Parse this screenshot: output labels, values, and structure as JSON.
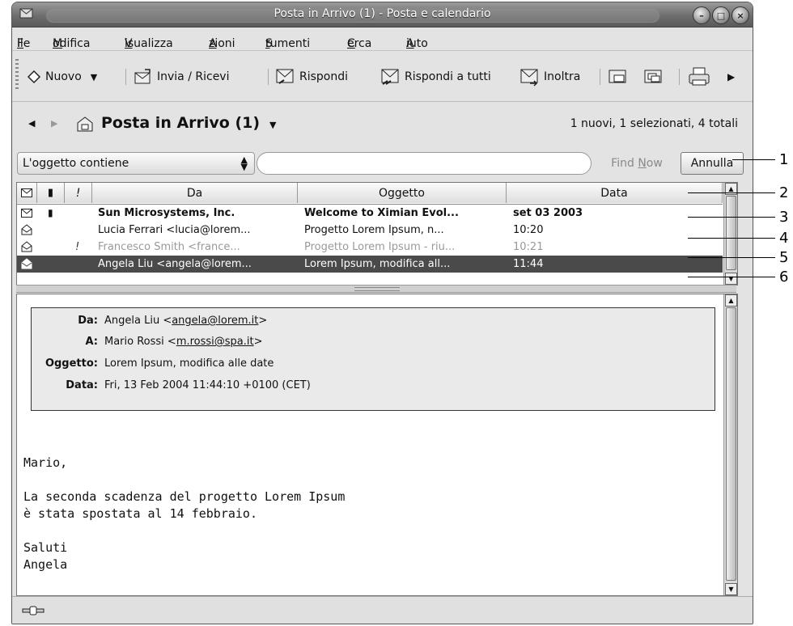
{
  "window": {
    "title": "Posta in Arrivo (1) - Posta e calendario"
  },
  "menu": [
    {
      "label": "File",
      "key": "F",
      "rest": "ile"
    },
    {
      "label": "Modifica",
      "key": "M",
      "rest": "odifica"
    },
    {
      "label": "Visualizza",
      "key": "V",
      "rest": "isualizza"
    },
    {
      "label": "Azioni",
      "key": "A",
      "rest": "zioni"
    },
    {
      "label": "Strumenti",
      "pre": "S",
      "key": "t",
      "rest": "rumenti"
    },
    {
      "label": "Cerca",
      "key": "C",
      "rest": "erca"
    },
    {
      "label": "Aiuto",
      "key": "A",
      "rest": "iuto"
    }
  ],
  "toolbar": {
    "new": "Nuovo",
    "send_receive": "Invia / Ricevi",
    "reply": "Rispondi",
    "reply_all": "Rispondi a tutti",
    "forward": "Inoltra"
  },
  "nav": {
    "folder": "Posta in Arrivo (1)",
    "counts": "1 nuovi, 1 selezionati, 4 totali"
  },
  "search": {
    "criteria": "L'oggetto contiene",
    "query": "",
    "find_now": "Find Now",
    "find_now_key": "N",
    "cancel": "Annulla"
  },
  "columns": {
    "from": "Da",
    "subject": "Oggetto",
    "date": "Data"
  },
  "messages": [
    {
      "from": "Sun Microsystems, Inc.",
      "subject": "Welcome to Ximian Evol...",
      "date": "set 03 2003",
      "flag": "",
      "unread": true,
      "attachment": true
    },
    {
      "from": "Lucia Ferrari <lucia@lorem...",
      "subject": "Progetto Lorem Ipsum, n...",
      "date": "10:20",
      "flag": "",
      "unread": false
    },
    {
      "from": "Francesco Smith <france...",
      "subject": "Progetto Lorem Ipsum - riu...",
      "date": "10:21",
      "flag": "!",
      "unread": false
    },
    {
      "from": "Angela Liu <angela@lorem...",
      "subject": "Lorem Ipsum, modifica all...",
      "date": "11:44",
      "flag": "",
      "unread": false,
      "selected": true
    }
  ],
  "preview": {
    "labels": {
      "from": "Da:",
      "to": "A:",
      "subject": "Oggetto:",
      "date": "Data:"
    },
    "from_name": "Angela Liu <",
    "from_email": "angela@lorem.it",
    "to_name": "Mario Rossi <",
    "to_email": "m.rossi@spa.it",
    "subject": "Lorem Ipsum, modifica alle date",
    "date": "Fri, 13 Feb 2004 11:44:10 +0100 (CET)",
    "body": "Mario,\n\nLa seconda scadenza del progetto Lorem Ipsum\nè stata spostata al 14 febbraio.\n\nSaluti\nAngela"
  },
  "callouts": [
    "1",
    "2",
    "3",
    "4",
    "5",
    "6"
  ]
}
